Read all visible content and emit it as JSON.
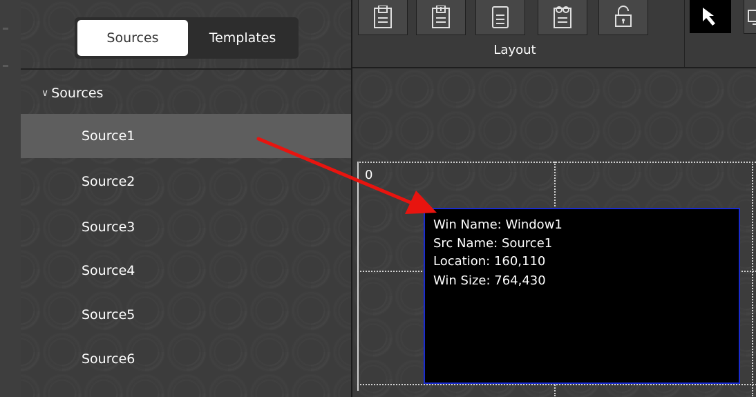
{
  "tabs": {
    "sources_label": "Sources",
    "templates_label": "Templates"
  },
  "tree": {
    "header_label": "Sources",
    "items": [
      {
        "label": "Source1",
        "selected": true
      },
      {
        "label": "Source2"
      },
      {
        "label": "Source3"
      },
      {
        "label": "Source4"
      },
      {
        "label": "Source5"
      },
      {
        "label": "Source6"
      }
    ]
  },
  "toolbar": {
    "group_label": "Layout",
    "buttons": [
      "save-layout-icon",
      "save-as-layout-icon",
      "layout-file-icon",
      "layout-settings-icon",
      "lock-layout-icon"
    ],
    "pointer_icon": "pointer-arrow-icon",
    "display_icon": "display-icon"
  },
  "canvas": {
    "origin_label": "0",
    "window": {
      "win_name_label": "Win Name:",
      "win_name_value": "Window1",
      "src_name_label": "Src Name:",
      "src_name_value": "Source1",
      "location_label": "Location:",
      "location_value": "160,110",
      "win_size_label": "Win Size:",
      "win_size_value": "764,430"
    }
  },
  "colors": {
    "panel_bg": "#3c3c3c",
    "selected_item": "#5e5e5e",
    "window_border": "#1a2ccf",
    "annotation_arrow": "#e8140f"
  }
}
